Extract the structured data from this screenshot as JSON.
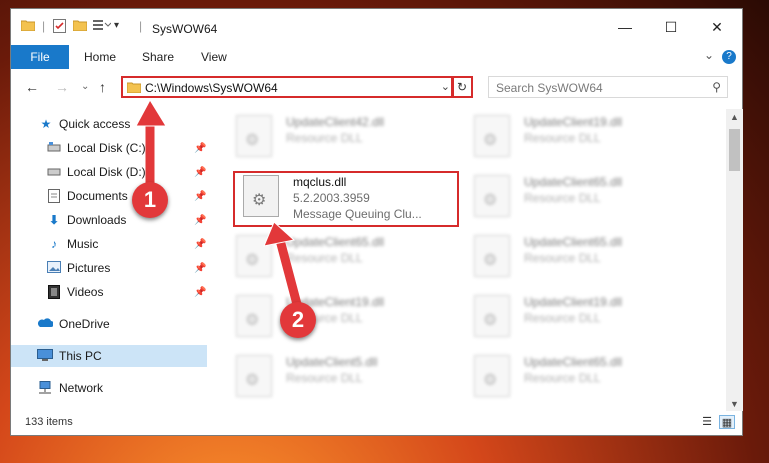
{
  "window": {
    "title": "SysWOW64",
    "minimize_glyph": "—",
    "maximize_glyph": "☐",
    "close_glyph": "✕"
  },
  "ribbon": {
    "tabs": [
      "File",
      "Home",
      "Share",
      "View"
    ],
    "expand_glyph": "⌄",
    "help_glyph": "?"
  },
  "address": {
    "path": "C:\\Windows\\SysWOW64",
    "search_placeholder": "Search SysWOW64"
  },
  "nav": {
    "items": [
      {
        "label": "Quick access",
        "icon": "star-icon"
      },
      {
        "label": "Local Disk (C:)",
        "icon": "drive-icon",
        "pinned": true
      },
      {
        "label": "Local Disk (D:)",
        "icon": "drive-icon",
        "pinned": true
      },
      {
        "label": "Documents",
        "icon": "documents-icon",
        "pinned": true
      },
      {
        "label": "Downloads",
        "icon": "downloads-icon",
        "pinned": true
      },
      {
        "label": "Music",
        "icon": "music-icon",
        "pinned": true
      },
      {
        "label": "Pictures",
        "icon": "pictures-icon",
        "pinned": true
      },
      {
        "label": "Videos",
        "icon": "videos-icon",
        "pinned": true
      },
      {
        "label": "OneDrive",
        "icon": "onedrive-icon"
      },
      {
        "label": "This PC",
        "icon": "this-pc-icon",
        "selected": true
      },
      {
        "label": "Network",
        "icon": "network-icon"
      }
    ]
  },
  "files": {
    "col1": [
      {
        "name": "UpdateClient42.dll",
        "type": "Resource DLL"
      },
      {
        "name": "mqclus.dll",
        "version": "5.2.2003.3959",
        "desc": "Message Queuing Clu..."
      },
      {
        "name": "UpdateClient65.dll",
        "type": "Resource DLL"
      },
      {
        "name": "UpdateClient19.dll",
        "type": "Resource DLL"
      },
      {
        "name": "UpdateClient5.dll",
        "type": "Resource DLL"
      }
    ],
    "col2": [
      {
        "name": "UpdateClient19.dll",
        "type": "Resource DLL"
      },
      {
        "name": "UpdateClient65.dll",
        "type": "Resource DLL"
      },
      {
        "name": "UpdateClient65.dll",
        "type": "Resource DLL"
      },
      {
        "name": "UpdateClient19.dll",
        "type": "Resource DLL"
      },
      {
        "name": "UpdateClient65.dll",
        "type": "Resource DLL"
      }
    ]
  },
  "status": {
    "count": "133 items"
  },
  "callouts": {
    "one": "1",
    "two": "2"
  },
  "colors": {
    "accent": "#1979ca",
    "highlight": "#d62b2b",
    "selection": "#cce4f7"
  }
}
